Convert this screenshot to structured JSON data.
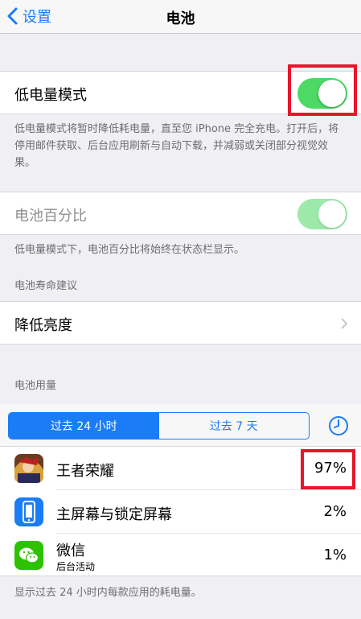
{
  "nav": {
    "back_label": "设置",
    "title": "电池"
  },
  "low_power": {
    "label": "低电量模式",
    "enabled": true,
    "description": "低电量模式将暂时降低耗电量，直至您 iPhone 完全充电。打开后，将停用邮件获取、后台应用刷新与自动下载，并减弱或关闭部分视觉效果。"
  },
  "battery_percentage": {
    "label": "电池百分比",
    "enabled": true,
    "description": "低电量模式下，电池百分比将始终在状态栏显示。"
  },
  "suggestions": {
    "header": "电池寿命建议",
    "item_label": "降低亮度"
  },
  "usage": {
    "header": "电池用量",
    "tabs": [
      "过去 24 小时",
      "过去 7 天"
    ],
    "selected_tab": "过去 24 小时",
    "apps": [
      {
        "name": "王者荣耀",
        "subtitle": "",
        "percent": "97%",
        "icon": "game-hero-icon"
      },
      {
        "name": "主屏幕与锁定屏幕",
        "subtitle": "",
        "percent": "2%",
        "icon": "home-lock-screen-icon"
      },
      {
        "name": "微信",
        "subtitle": "后台活动",
        "percent": "1%",
        "icon": "wechat-icon"
      }
    ],
    "footer": "显示过去 24 小时内每款应用的耗电量。"
  },
  "colors": {
    "accent": "#1a7cf7",
    "switch_on": "#4cd964",
    "highlight": "#e8152b"
  }
}
